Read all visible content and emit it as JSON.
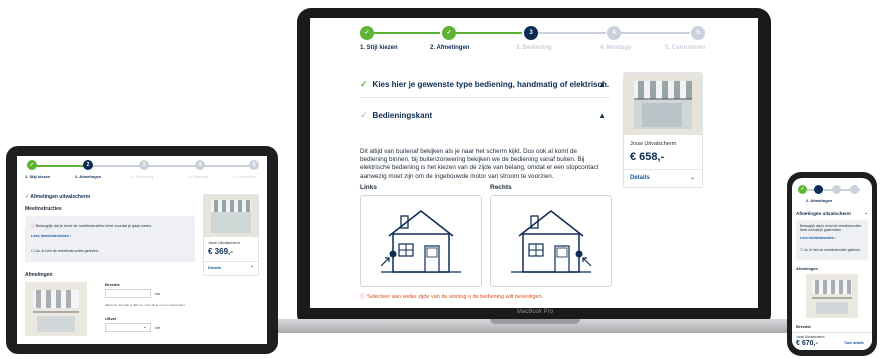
{
  "laptop": {
    "steps": [
      {
        "number": "",
        "label": "1. Stijl kiezen",
        "state": "done"
      },
      {
        "number": "",
        "label": "2. Afmetingen",
        "state": "done"
      },
      {
        "number": "3",
        "label": "3. Bediening",
        "state": "current"
      },
      {
        "number": "4",
        "label": "4. Montage",
        "state": "todo"
      },
      {
        "number": "5",
        "label": "5. Controleren",
        "state": "todo"
      }
    ],
    "section1_title": "Kies hier je gewenste type bediening, handmatig of elektrisch.",
    "section2_title": "Bedieningskant",
    "body_text": "Dit altijd van buitenaf bekijken als je naar het scherm kijkt. Dus ook al komt de bediening binnen, bij buitenzonwering bekijken we de bediening vanaf buiten. Bij elektrische bediening is het kiezen van de zijde van belang, omdat er een stopcontact aanwezig moet zijn om de ingebouwde motor van stroom te voorzien.",
    "option_left": "Links",
    "option_right": "Rechts",
    "warning": "Selecteer aan welke zijde van de woning u de bediening wilt bevestigen.",
    "product_name": "Jouw Uitvalscherm",
    "product_price": "€ 658,-",
    "details": "Details",
    "brand": "MacBook Pro"
  },
  "tablet": {
    "steps": [
      {
        "number": "",
        "label": "1. Stijl kiezen",
        "state": "done"
      },
      {
        "number": "2",
        "label": "2. Afmetingen",
        "state": "current"
      },
      {
        "number": "3",
        "label": "3. Bediening",
        "state": "todo"
      },
      {
        "number": "4",
        "label": "4. Montage",
        "state": "todo"
      },
      {
        "number": "5",
        "label": "5. Controleren",
        "state": "todo"
      }
    ],
    "section_title": "Afmetingen uitvalscherm",
    "measure_title": "Meetinstructies",
    "notice": "Belangrijk dat je eerst de meetinstructies leest voordat je gaat meten.",
    "read_link": "Lees meetinstructies  ›",
    "confirm": "Ja, ik heb de meetinstructies gelezen.",
    "dimensions_title": "Afmetingen",
    "width_label": "Breedte",
    "unit": "cm",
    "hint": "Maximum breedte is 400 cm, zorg dat je op een stopcontact",
    "height_label": "Uitval",
    "product_name": "Jouw Uitvalscherm",
    "product_price": "€ 369,-",
    "details": "Details"
  },
  "phone": {
    "step_label": "2. Afmetingen",
    "section_title": "Afmetingen uitvalscherm",
    "notice": "Belangrijk dat je eerst de meetinstructies leest voordat je gaat meten.",
    "read_link": "Lees meetinstructies  ›",
    "confirm": "Ja, ik heb de meetinstructies gelezen.",
    "dimensions_title": "Afmetingen",
    "width_label": "Breedte",
    "product_name": "Jouw Uitvalscherm",
    "product_price": "€ 670,-",
    "details": "Toon details"
  },
  "colors": {
    "done": "#5fb335",
    "current": "#0d2c54",
    "todo": "#c9d1dc",
    "warning": "#d9531e"
  }
}
